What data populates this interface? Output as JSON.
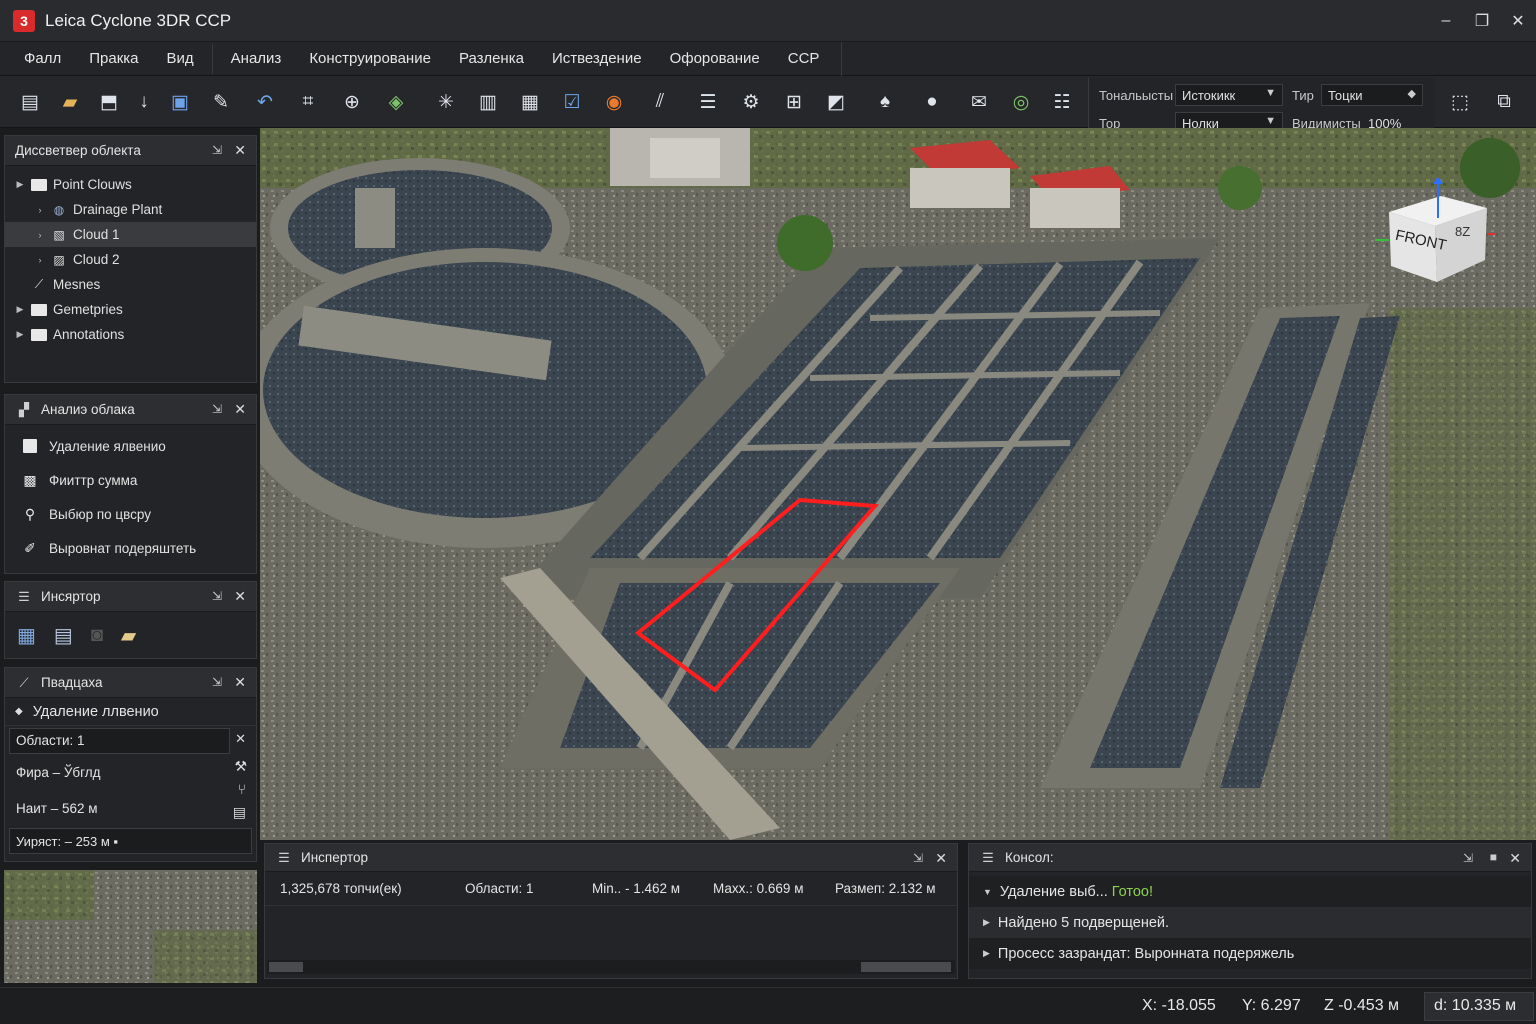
{
  "app": {
    "title": "Leica Cyclone 3DR CCP",
    "logo": "3"
  },
  "window_controls": {
    "minimize": "–",
    "maximize": "❐",
    "close": "✕"
  },
  "menu": [
    "Фалл",
    "Пракка",
    "Вид",
    "Анализ",
    "Конструирование",
    "Разленка",
    "Иствездение",
    "Офорование",
    "CCP"
  ],
  "properties": {
    "tonal_label": "Тональысты",
    "tonal_value": "Истокикк",
    "type_label": "Тир",
    "type_value": "Тоцки",
    "top_label": "Тор",
    "top_value": "Нолки",
    "visibility_label": "Видимисты",
    "visibility_value": "100%"
  },
  "dispatcher": {
    "title": "Диссветвер облекта",
    "items": [
      {
        "label": "Point Clouws"
      },
      {
        "label": "Drainage Plant"
      },
      {
        "label": "Cloud 1"
      },
      {
        "label": "Cloud 2"
      },
      {
        "label": "Mesnes"
      },
      {
        "label": "Gemetpries"
      },
      {
        "label": "Annotations"
      }
    ]
  },
  "analysis": {
    "title": "Аналиэ облака",
    "items": [
      "Удаление ялвенио",
      "Фииттр сумма",
      "Выбюр по цвсру",
      "Выровнат подеряштеть"
    ]
  },
  "inspector_small": {
    "title": "Инсяртор"
  },
  "platform": {
    "title": "Пвадцаха",
    "subtitle": "Удаление ллвенио",
    "field_areas": "Области: 1",
    "field_figure": "Фира  –  Ўбглд",
    "field_height": "Наит  –   562 м",
    "field_width": "Уиряст:  –  253 м  ▪"
  },
  "viewcube": {
    "face": "FRONT",
    "side": "8Z"
  },
  "inspector": {
    "title": "Инспертор",
    "points": "1,325,678 топчи(ек)",
    "areas": "Области: 1",
    "min": "Min.. - 1.462 м",
    "max": "Махх.: 0.669 м",
    "size": "Размеп: 2.132 м"
  },
  "console": {
    "title": "Консол:",
    "lines": [
      {
        "text": "Удаление выб... ",
        "highlight": "Готоо!"
      },
      {
        "text": "Найдено 5 подверщеней.",
        "highlight": ""
      },
      {
        "text": "Просесс зазрандат: Выронната подеряжель",
        "highlight": ""
      }
    ]
  },
  "status": {
    "x": "X: -18.055",
    "y": "Y: 6.297",
    "z": "Z -0.453 м",
    "d": "d: 10.335 м"
  },
  "colors": {
    "accent": "#d92b2b",
    "selection": "#ff1e1e",
    "success": "#8fd14f"
  }
}
